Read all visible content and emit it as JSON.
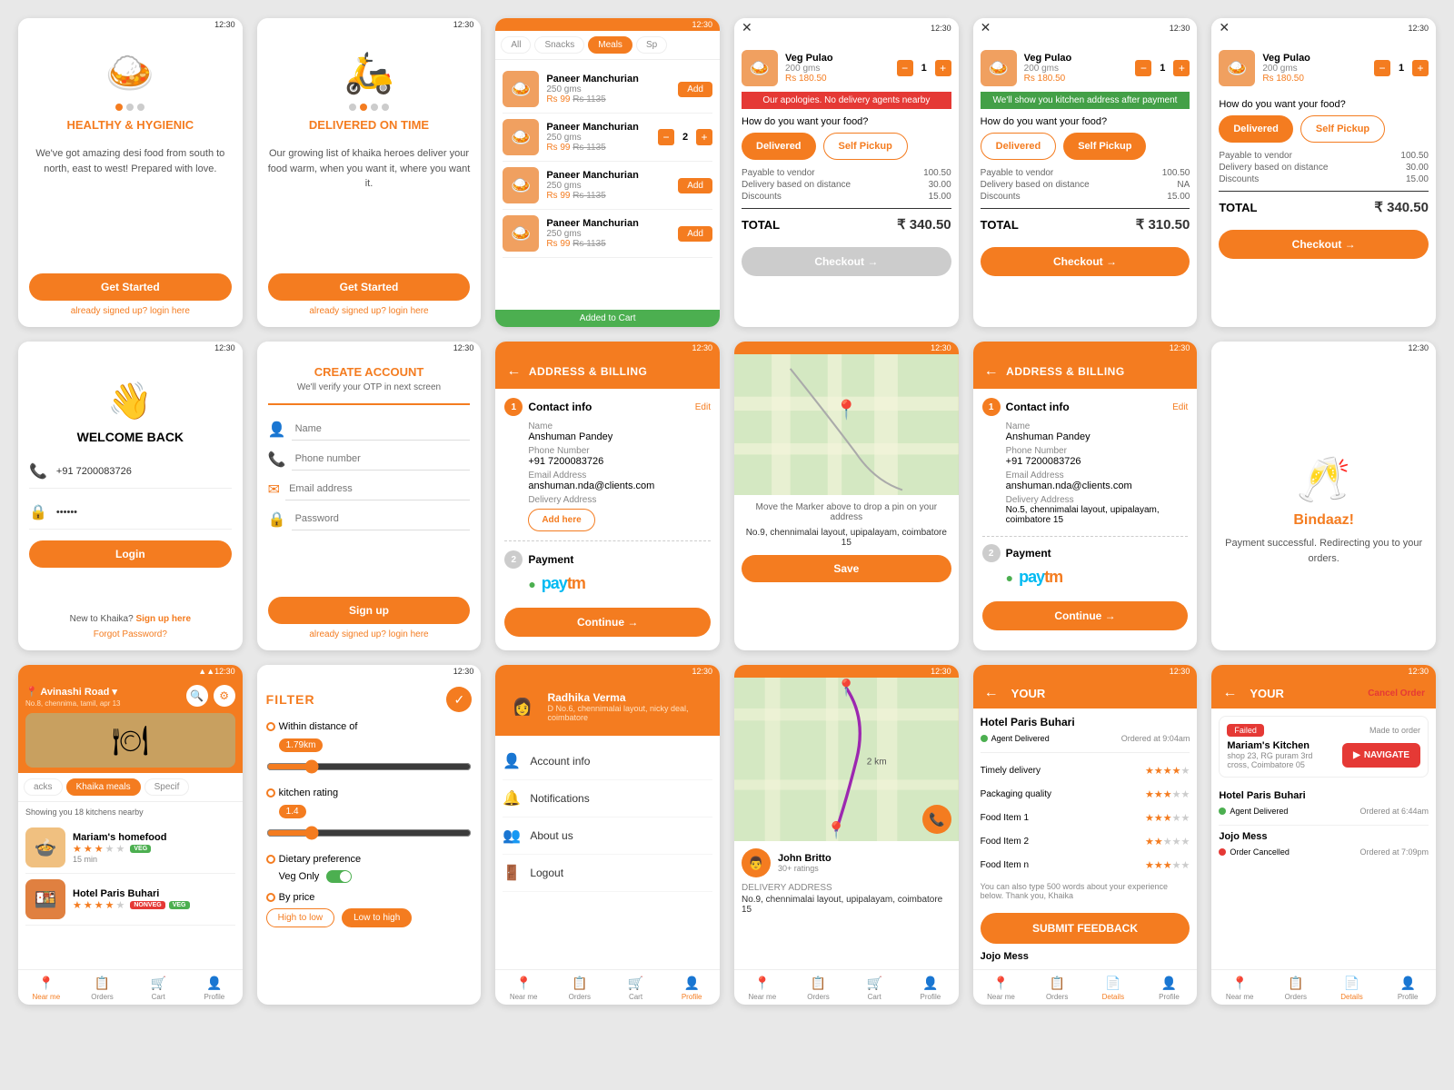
{
  "screens": {
    "row1": [
      {
        "id": "s1-1",
        "type": "onboarding1",
        "title": "HEALTHY & HYGIENIC",
        "body": "We've got amazing desi food from south to north, east to west! Prepared with love.",
        "btn": "Get Started",
        "link": "already signed up? login here",
        "icon": "🍛",
        "activeDot": 1
      },
      {
        "id": "s1-2",
        "type": "onboarding2",
        "title": "DELIVERED ON TIME",
        "body": "Our growing list of khaika heroes deliver your food warm, when you want it, where you want it.",
        "btn": "Get Started",
        "link": "already signed up? login here",
        "icon": "🛵",
        "activeDot": 2
      },
      {
        "id": "s1-3",
        "type": "menu",
        "tabs": [
          "All",
          "Snacks",
          "Meals",
          "Sp"
        ],
        "activeTab": "Meals",
        "items": [
          {
            "name": "Paneer Manchurian",
            "weight": "250 gms",
            "price": "Rs 99",
            "mrp": "Rs 1135",
            "qty": 0
          },
          {
            "name": "Paneer Manchurian",
            "weight": "250 gms",
            "price": "Rs 99",
            "mrp": "Rs 1135",
            "qty": 2
          },
          {
            "name": "Paneer Manchurian",
            "weight": "250 gms",
            "price": "Rs 99",
            "mrp": "Rs 1135",
            "qty": 0
          },
          {
            "name": "Paneer Manchurian",
            "weight": "250 gms",
            "price": "Rs 99",
            "mrp": "Rs 1135",
            "qty": 0
          }
        ],
        "toast": "Added to Cart"
      },
      {
        "id": "s1-4",
        "type": "cart1",
        "itemName": "Veg Pulao",
        "itemWeight": "200 gms",
        "itemPrice": "Rs 180.50",
        "alert": "Our apologies. No delivery agents nearby",
        "alertType": "red",
        "question": "How do you want your food?",
        "deliveryLabel": "Delivered",
        "selfPickupLabel": "Self Pickup",
        "details": [
          {
            "label": "Payable to vendor",
            "value": "100.50"
          },
          {
            "label": "Delivery based on distance",
            "value": "30.00"
          },
          {
            "label": "Discounts",
            "value": "15.00"
          }
        ],
        "total": "TOTAL",
        "totalAmount": "₹  340.50",
        "checkoutBtn": "Checkout →",
        "checkoutDisabled": true
      },
      {
        "id": "s1-5",
        "type": "cart2",
        "itemName": "Veg Pulao",
        "itemWeight": "200 gms",
        "itemPrice": "Rs 180.50",
        "alert": "We'll show you kitchen address after payment",
        "alertType": "green",
        "question": "How do you want your food?",
        "deliveryLabel": "Delivered",
        "selfPickupLabel": "Self Pickup",
        "details": [
          {
            "label": "Payable to vendor",
            "value": "100.50"
          },
          {
            "label": "Delivery based on distance",
            "value": "NA"
          },
          {
            "label": "Discounts",
            "value": "15.00"
          }
        ],
        "total": "TOTAL",
        "totalAmount": "₹  310.50",
        "checkoutBtn": "Checkout →"
      },
      {
        "id": "s1-6",
        "type": "cart3",
        "itemName": "Veg Pulao",
        "itemWeight": "200 gms",
        "itemPrice": "Rs 180.50",
        "question": "How do you want your food?",
        "deliveryLabel": "Delivered",
        "selfPickupLabel": "Self Pickup",
        "details": [
          {
            "label": "Payable to vendor",
            "value": "100.50"
          },
          {
            "label": "Delivery based on distance",
            "value": "30.00"
          },
          {
            "label": "Discounts",
            "value": "15.00"
          }
        ],
        "total": "TOTAL",
        "totalAmount": "₹  340.50",
        "checkoutBtn": "Checkout →"
      }
    ],
    "row2": [
      {
        "id": "s2-1",
        "type": "login",
        "icon": "👋",
        "title": "WELCOME BACK",
        "phonePlaceholder": "+91 7200083726",
        "passwordPlaceholder": "••••••",
        "btnLabel": "Login",
        "newUserText": "New to Khaika?",
        "signupLink": "Sign up here",
        "forgotLink": "Forgot Password?"
      },
      {
        "id": "s2-2",
        "type": "signup",
        "title": "CREATE ACCOUNT",
        "subtitle": "We'll verify your OTP in next screen",
        "fields": [
          "Name",
          "Phone number",
          "Email address",
          "Password"
        ],
        "btnLabel": "Sign up",
        "loginText": "already signed up?",
        "loginLink": "login here"
      },
      {
        "id": "s2-3",
        "type": "address1",
        "headerTitle": "ADDRESS & BILLING",
        "section1": "Contact info",
        "editLabel": "Edit",
        "nameLabel": "Name",
        "nameValue": "Anshuman Pandey",
        "phoneLabel": "Phone Number",
        "phoneValue": "+91 7200083726",
        "emailLabel": "Email Address",
        "emailValue": "anshuman.nda@clients.com",
        "deliveryLabel": "Delivery Address",
        "addHereBtn": "Add here",
        "section2": "Payment",
        "paymentMethod": "paytm",
        "continueBtn": "Continue →"
      },
      {
        "id": "s2-4",
        "type": "mappin",
        "instruction": "Move the Marker above to drop a pin on your address",
        "addressValue": "No.9, chennimalai layout, upipalayam, coimbatore 15",
        "saveBtn": "Save"
      },
      {
        "id": "s2-5",
        "type": "address2",
        "headerTitle": "ADDRESS & BILLING",
        "section1": "Contact info",
        "editLabel": "Edit",
        "nameLabel": "Name",
        "nameValue": "Anshuman Pandey",
        "phoneLabel": "Phone Number",
        "phoneValue": "+91 7200083726",
        "emailLabel": "Email Address",
        "emailValue": "anshuman.nda@clients.com",
        "deliveryLabel": "Delivery Address",
        "deliveryValue": "No.5, chennimalai layout, upipalayam, coimbatore 15",
        "section2": "Payment",
        "paymentMethod": "paytm",
        "continueBtn": "Continue →"
      },
      {
        "id": "s2-6",
        "type": "success",
        "icon": "🥂",
        "title": "Bindaaz!",
        "message": "Payment successful. Redirecting you to your orders."
      }
    ],
    "row3": [
      {
        "id": "s3-1",
        "type": "home",
        "location": "Avinashi Road ▾",
        "subtitle": "No.8, chennima, tamil, apr 13",
        "tabs": [
          "acks",
          "Khaika meals",
          "Specif"
        ],
        "activeTab": "Khaika meals",
        "showingText": "Showing you 18 kitchens nearby",
        "kitchens": [
          {
            "name": "Mariam's homefood",
            "rating": 3,
            "tags": [
              "VEG"
            ],
            "time": "15 min"
          },
          {
            "name": "Hotel Paris Buhari",
            "rating": 4,
            "tags": [
              "NONVEG",
              "VEG"
            ]
          }
        ],
        "tabBar": [
          "Near me",
          "Orders",
          "Cart",
          "Profile"
        ]
      },
      {
        "id": "s3-2",
        "type": "filter",
        "title": "FILTER",
        "distanceLabel": "Within distance of",
        "distanceValue": "1.79km",
        "ratingLabel": "kitchen rating",
        "ratingValue": "1.4",
        "dietLabel": "Dietary preference",
        "dietValue": "Veg Only",
        "priceLabel": "By price",
        "priceOptions": [
          "High to low",
          "Low to high"
        ],
        "activePriceOption": "Low to high"
      },
      {
        "id": "s3-3",
        "type": "profile",
        "name": "Radhika Verma",
        "address": "D No.6, chennimalai layout, nicky deal, coimbatore",
        "menuItems": [
          {
            "icon": "👤",
            "label": "Account info"
          },
          {
            "icon": "🔔",
            "label": "Notifications"
          },
          {
            "icon": "👥",
            "label": "About us"
          },
          {
            "icon": "🚪",
            "label": "Logout"
          }
        ],
        "tabBar": [
          "Near me",
          "Orders",
          "Cart",
          "Profile"
        ]
      },
      {
        "id": "s3-4",
        "type": "tracking",
        "driverName": "John Britto",
        "driverRatings": "30+ ratings",
        "deliveryAddress": "No.9, chennimalai layout, upipalayam,",
        "deliveryAddress2": "No.9, chennimalai layout, upipalayam, coimbatore 15"
      },
      {
        "id": "s3-5",
        "type": "feedback",
        "headerTitle": "YOUR",
        "restaurant": "Hotel Paris Buhari",
        "status1": "Agent Delivered",
        "status1time": "Ordered at 9:04am",
        "categories": [
          {
            "label": "Timely delivery",
            "stars": 4
          },
          {
            "label": "Packaging quality",
            "stars": 3
          },
          {
            "label": "Food Item 1",
            "stars": 3
          },
          {
            "label": "Food Item 2",
            "stars": 2
          },
          {
            "label": "Food Item n",
            "stars": 3
          }
        ],
        "feedbackHint": "You can also type 500 words about your experience below. Thank you, Khaika",
        "submitBtn": "SUBMIT FEEDBACK",
        "restaurant2": "Jojo Mess",
        "tabBar": [
          "Near me",
          "Orders",
          "Details",
          "Profile"
        ]
      },
      {
        "id": "s3-6",
        "type": "orders",
        "headerTitle": "YOUR",
        "cancelLink": "Cancel Order",
        "order1": {
          "status": "Failed",
          "statusColor": "red",
          "kitchen": "Mariam's Kitchen",
          "kitchenAddress": "shop 23, RG puram 3rd cross, Coimbatore 05",
          "navigateBtn": "NAVIGATE"
        },
        "order2": {
          "restaurant": "Hotel Paris Buhari",
          "agentStatus": "Agent Delivered",
          "time": "Ordered at 6:44am"
        },
        "order3": {
          "restaurant": "Jojo Mess",
          "agentStatus": "Order Cancelled",
          "time": "Ordered at 7:09pm"
        },
        "tabBar": [
          "Near me",
          "Orders",
          "Details",
          "Profile"
        ]
      }
    ]
  }
}
